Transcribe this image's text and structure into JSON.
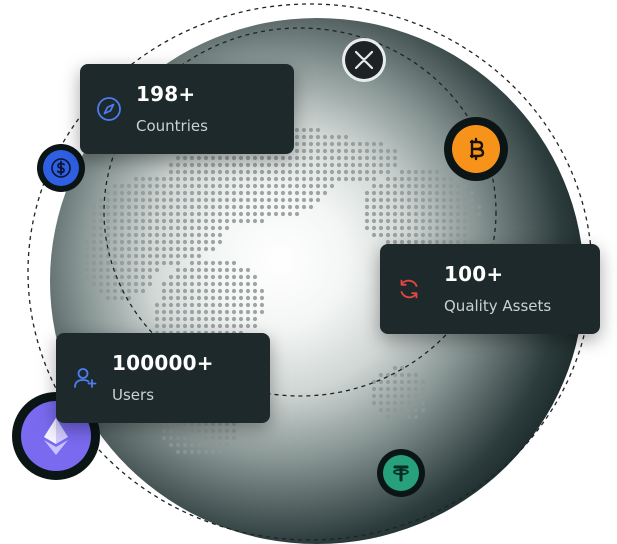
{
  "stats": [
    {
      "value": "198+",
      "label": "Countries",
      "icon": "compass-icon",
      "color": "#4c7df0"
    },
    {
      "value": "100+",
      "label": "Quality Assets",
      "icon": "refresh-icon",
      "color": "#e0473e"
    },
    {
      "value": "100000+",
      "label": "Users",
      "icon": "user-add-icon",
      "color": "#4c7df0"
    }
  ],
  "coins": [
    {
      "name": "xrp-coin-icon",
      "color": "#1d2225"
    },
    {
      "name": "bitcoin-coin-icon",
      "color": "#f7931a"
    },
    {
      "name": "dollar-coin-icon",
      "color": "#2f5fe3"
    },
    {
      "name": "ethereum-coin-icon",
      "color": "#7a6af0"
    },
    {
      "name": "tether-coin-icon",
      "color": "#26a17b"
    }
  ],
  "colors": {
    "card": "#1e292c",
    "globe_dark": "#0e1c1d",
    "map_dots": "#8e9696"
  }
}
